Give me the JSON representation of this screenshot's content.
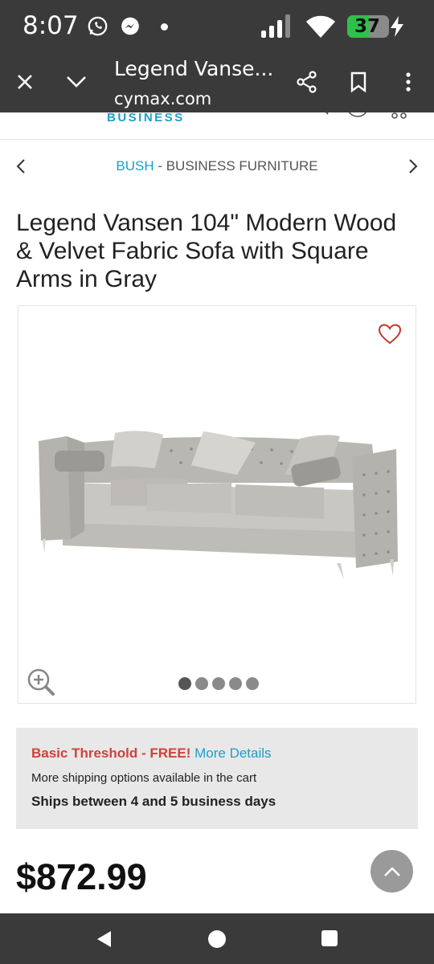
{
  "status_bar": {
    "time": "8:07",
    "battery": "37",
    "icons": [
      "whatsapp-icon",
      "messenger-icon",
      "dot-icon",
      "signal-icon",
      "wifi-icon",
      "battery-charging-icon"
    ]
  },
  "browser": {
    "page_title": "Legend Vanse...",
    "url": "cymax.com",
    "icons": [
      "close-icon",
      "chevron-down-icon",
      "share-icon",
      "bookmark-icon",
      "more-vert-icon"
    ]
  },
  "site": {
    "logo_text": "BUSINESS"
  },
  "breadcrumb": {
    "brand": "BUSH",
    "separator": " - ",
    "category": "BUSINESS FURNITURE"
  },
  "product": {
    "title": "Legend Vansen 104\" Modern Wood & Velvet Fabric Sofa with Square Arms in Gray",
    "price": "$872.99",
    "image_count": 5,
    "active_image": 1
  },
  "shipping": {
    "threshold_label": "Basic Threshold - FREE!",
    "details_link": "More Details",
    "options_note": "More shipping options available in the cart",
    "ships_between": "Ships between 4 and 5 business days"
  },
  "colors": {
    "accent": "#1aa0c8",
    "alert_red": "#d43f3a",
    "chrome_bg": "#3a3a3a",
    "shipping_bg": "#e8e8e8",
    "heart": "#c0392b"
  }
}
